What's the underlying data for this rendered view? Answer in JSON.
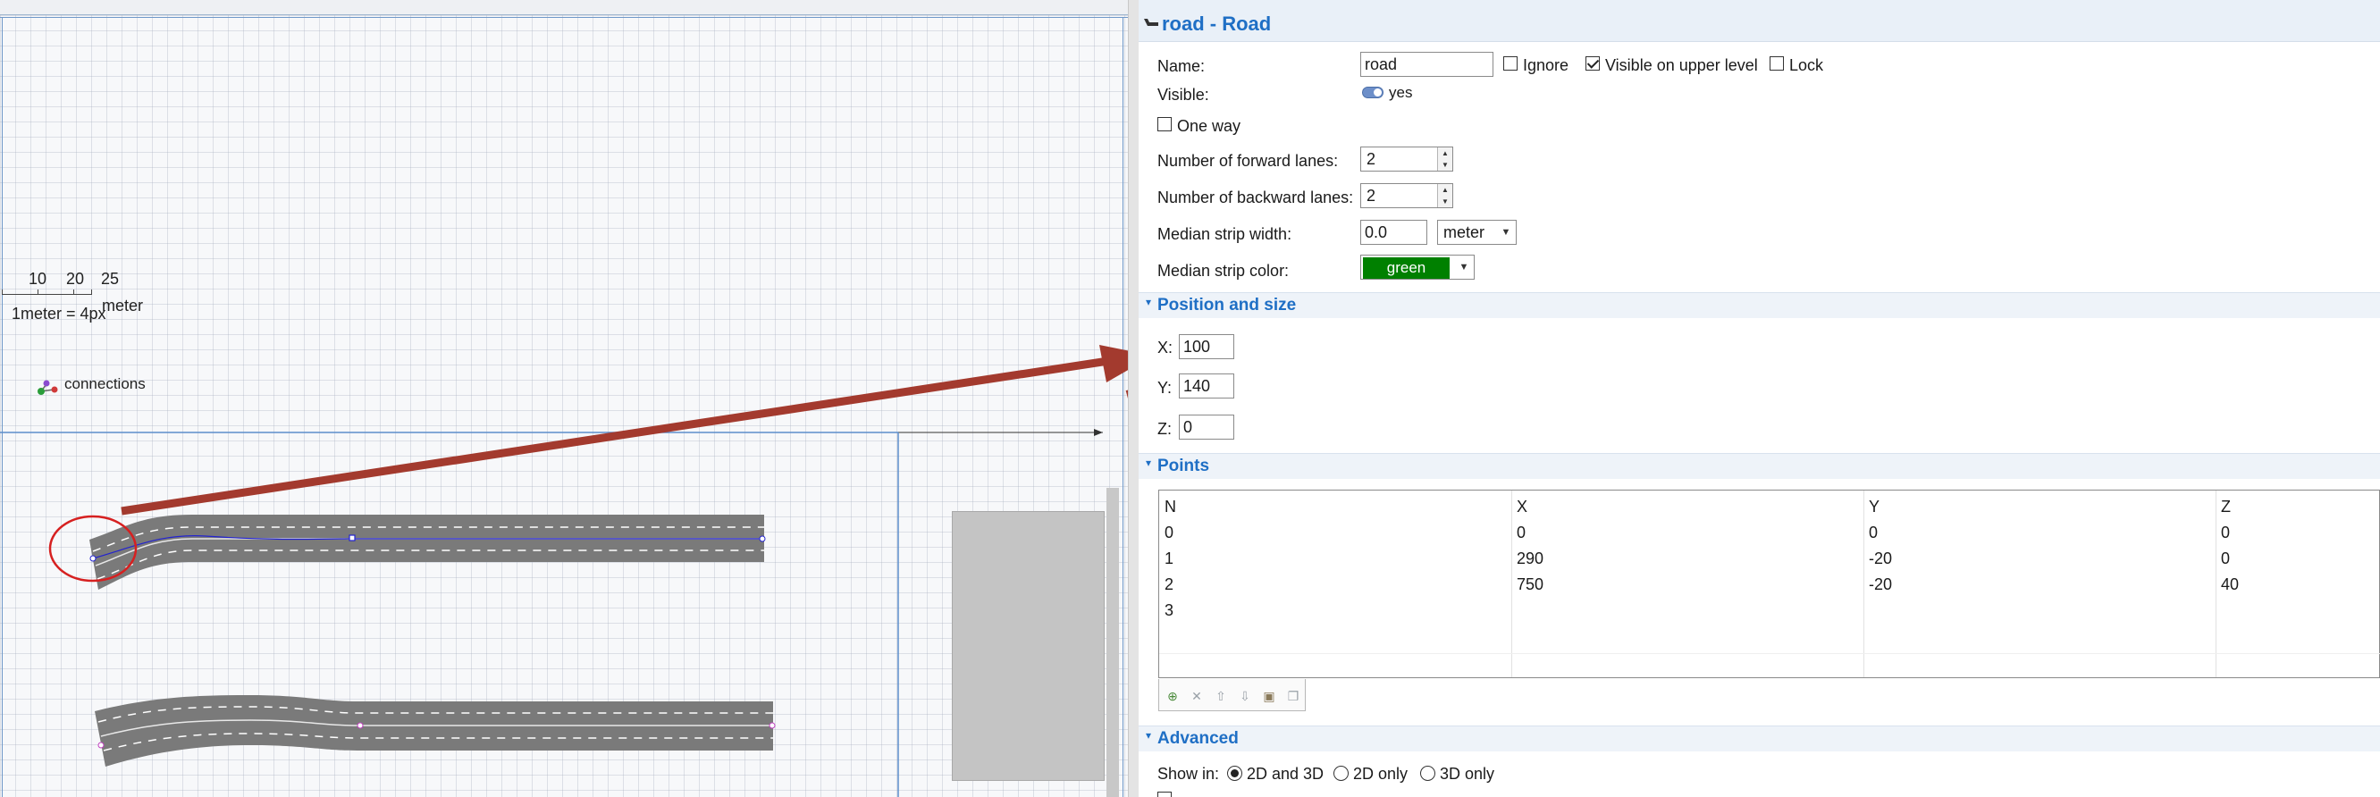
{
  "canvas": {
    "scale": {
      "ticks": [
        "10",
        "20",
        "25"
      ],
      "unit": "meter",
      "ratio": "1meter = 4px"
    },
    "connections_label": "connections"
  },
  "panel": {
    "title": "road - Road",
    "name_label": "Name:",
    "name_value": "road",
    "ignore_label": "Ignore",
    "ignore_checked": false,
    "visible_upper_label": "Visible on upper level",
    "visible_upper_checked": true,
    "lock_label": "Lock",
    "lock_checked": false,
    "visible_label": "Visible:",
    "visible_value": "yes",
    "one_way_label": "One way",
    "one_way_checked": false,
    "forward_lanes_label": "Number of forward lanes:",
    "forward_lanes_value": "2",
    "backward_lanes_label": "Number of backward lanes:",
    "backward_lanes_value": "2",
    "median_width_label": "Median strip width:",
    "median_width_value": "0.0",
    "median_width_unit": "meter",
    "median_color_label": "Median strip color:",
    "median_color_value": "green",
    "median_color_hex": "#008000",
    "position_section": "Position and size",
    "x_label": "X:",
    "x_value": "100",
    "y_label": "Y:",
    "y_value": "140",
    "z_label": "Z:",
    "z_value": "0",
    "points_section": "Points",
    "points_table": {
      "headers": [
        "N",
        "X",
        "Y",
        "Z"
      ],
      "rows": [
        [
          "0",
          "0",
          "0",
          "0"
        ],
        [
          "1",
          "290",
          "-20",
          "0"
        ],
        [
          "2",
          "750",
          "-20",
          "40"
        ],
        [
          "3",
          "",
          "",
          ""
        ]
      ]
    },
    "table_toolbar_icons": [
      "add-point-icon",
      "delete-point-icon",
      "move-up-icon",
      "move-down-icon",
      "paste-icon",
      "copy-icon"
    ],
    "advanced_section": "Advanced",
    "show_in_label": "Show in:",
    "show_in_options": [
      "2D and 3D",
      "2D only",
      "3D only"
    ],
    "show_in_selected": "2D and 3D"
  },
  "colors": {
    "accent": "#1f6fc5",
    "annotation_arrow": "#a33a2e",
    "annotation_circle": "#d62020",
    "road": "#7a7a7a",
    "road_path": "#2222d0"
  }
}
